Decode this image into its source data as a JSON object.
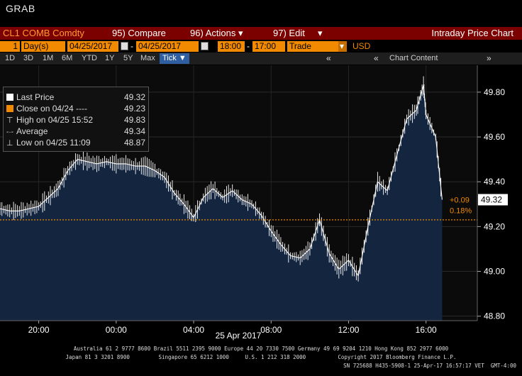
{
  "window_title": "GRAB",
  "toolbar": {
    "ticker": "CL1 COMB Comdty",
    "compare_num": "95)",
    "compare_label": "Compare",
    "actions_num": "96)",
    "actions_label": "Actions",
    "edit_num": "97)",
    "edit_label": "Edit",
    "chart_title": "Intraday Price Chart"
  },
  "params": {
    "period": "1",
    "period_unit": "Day(s)",
    "start_date": "04/25/2017",
    "end_date": "04/25/2017",
    "start_time": "18:00",
    "end_time": "17:00",
    "event": "Trade",
    "currency": "USD"
  },
  "ranges": [
    "1D",
    "3D",
    "1M",
    "6M",
    "YTD",
    "1Y",
    "5Y",
    "Max"
  ],
  "tick_label": "Tick",
  "chart_content_label": "Chart Content",
  "legend": [
    {
      "label": "Last Price",
      "value": "49.32",
      "color": "#ffffff",
      "marker": "box"
    },
    {
      "label": "Close on 04/24 ----",
      "value": "49.23",
      "color": "#f28a00",
      "marker": "box"
    },
    {
      "label": "High on 04/25 15:52",
      "value": "49.83",
      "color": "#ffffff",
      "marker": "T"
    },
    {
      "label": "Average",
      "value": "49.34",
      "color": "#ffffff",
      "marker": "avg"
    },
    {
      "label": "Low on 04/25 11:09",
      "value": "48.87",
      "color": "#ffffff",
      "marker": "L"
    }
  ],
  "chart_data": {
    "type": "area",
    "xlabel": "25 Apr 2017",
    "x_ticks": [
      "20:00",
      "00:00",
      "04:00",
      "08:00",
      "12:00",
      "16:00"
    ],
    "y_ticks": [
      "49.80",
      "49.60",
      "49.40",
      "49.20",
      "49.00",
      "48.80"
    ],
    "ylim": [
      48.78,
      49.92
    ],
    "xlim_hours_from_1800": [
      0,
      23
    ],
    "grid": true,
    "previous_close": 49.23,
    "last_price": 49.32,
    "change": "+0.09",
    "change_pct": "0.18%",
    "last_price_label": "49.32",
    "series": [
      {
        "x": [
          "18:00",
          "18:30",
          "19:00",
          "19:30",
          "20:00",
          "20:30",
          "21:00",
          "21:30",
          "22:00",
          "22:30",
          "23:00",
          "23:30",
          "00:00",
          "00:30",
          "01:00",
          "01:30",
          "02:00",
          "02:30",
          "03:00",
          "03:30",
          "04:00",
          "04:30",
          "05:00",
          "05:30",
          "06:00",
          "06:30",
          "07:00",
          "07:30",
          "08:00",
          "08:30",
          "09:00",
          "09:30",
          "10:00",
          "10:30",
          "11:00",
          "11:30",
          "12:00",
          "12:30",
          "13:00",
          "13:30",
          "14:00",
          "14:30",
          "15:00",
          "15:30",
          "15:52",
          "16:00",
          "16:30",
          "16:50"
        ],
        "values": [
          49.28,
          49.27,
          49.27,
          49.28,
          49.29,
          49.33,
          49.37,
          49.45,
          49.5,
          49.49,
          49.48,
          49.49,
          49.48,
          49.48,
          49.47,
          49.47,
          49.45,
          49.42,
          49.35,
          49.3,
          49.24,
          49.33,
          49.37,
          49.33,
          49.36,
          49.32,
          49.3,
          49.25,
          49.18,
          49.12,
          49.07,
          49.06,
          49.1,
          49.23,
          49.08,
          49.01,
          49.05,
          48.98,
          49.2,
          49.4,
          49.36,
          49.52,
          49.68,
          49.72,
          49.83,
          49.7,
          49.6,
          49.32
        ],
        "color": "#ffffff"
      }
    ]
  },
  "footer": {
    "line1": "Australia 61 2 9777 8600 Brazil 5511 2395 9000 Europe 44 20 7330 7500 Germany 49 69 9204 1210 Hong Kong 852 2977 6000",
    "line2": "Japan 81 3 3201 8900         Singapore 65 6212 1000     U.S. 1 212 318 2000          Copyright 2017 Bloomberg Finance L.P.",
    "line3": "SN 725688 H435-5908-1 25-Apr-17 16:57:17 VET  GMT-4:00"
  },
  "colors": {
    "toolbar_red": "#7b0000",
    "accent_orange": "#f28a00",
    "area_fill": "#14263f",
    "tick_blue": "#2f5fa0"
  }
}
